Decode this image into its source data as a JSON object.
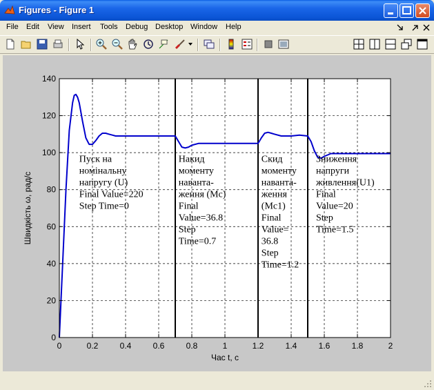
{
  "window": {
    "title": "Figures - Figure 1"
  },
  "menu": [
    {
      "label": "File"
    },
    {
      "label": "Edit"
    },
    {
      "label": "View"
    },
    {
      "label": "Insert"
    },
    {
      "label": "Tools"
    },
    {
      "label": "Debug"
    },
    {
      "label": "Desktop"
    },
    {
      "label": "Window"
    },
    {
      "label": "Help"
    }
  ],
  "colors": {
    "title_bar": "#0b55d6",
    "figure_bg": "#c8c8c8",
    "series": "#0000cc"
  },
  "icons": [
    "new-figure-icon",
    "open-file-icon",
    "save-icon",
    "print-icon",
    "pointer-icon",
    "zoom-in-icon",
    "zoom-out-icon",
    "pan-icon",
    "rotate-icon",
    "data-cursor-icon",
    "brush-icon",
    "link-icon",
    "colorbar-icon",
    "legend-icon",
    "hide-tools-icon",
    "show-tools-icon",
    "tile-icon",
    "split-vertical-icon",
    "split-horizontal-icon",
    "float-icon",
    "dock-icon"
  ],
  "chart_data": {
    "type": "line",
    "title": "",
    "xlabel": "Час t, с",
    "ylabel": "Швидкість ω, рад/с",
    "xlim": [
      0,
      2
    ],
    "ylim": [
      0,
      140
    ],
    "xticks": [
      "0",
      "0.2",
      "0.4",
      "0.6",
      "0.8",
      "1",
      "1.2",
      "1.4",
      "1.6",
      "1.8",
      "2"
    ],
    "yticks": [
      "0",
      "20",
      "40",
      "60",
      "80",
      "100",
      "120",
      "140"
    ],
    "grid": true,
    "vlines": [
      0.7,
      1.2,
      1.5
    ],
    "series": [
      {
        "x": [
          0,
          0.02,
          0.04,
          0.06,
          0.08,
          0.09,
          0.1,
          0.11,
          0.12,
          0.14,
          0.16,
          0.18,
          0.2,
          0.22,
          0.24,
          0.26,
          0.28,
          0.3,
          0.32,
          0.34,
          0.36,
          0.4,
          0.45,
          0.5,
          0.6,
          0.7,
          0.72,
          0.74,
          0.76,
          0.78,
          0.8,
          0.84,
          0.9,
          1.0,
          1.1,
          1.2,
          1.22,
          1.24,
          1.26,
          1.28,
          1.3,
          1.34,
          1.4,
          1.45,
          1.5,
          1.52,
          1.54,
          1.56,
          1.58,
          1.6,
          1.64,
          1.7,
          1.8,
          1.9,
          2.0
        ],
        "y": [
          0,
          40,
          80,
          112,
          127,
          131,
          131.5,
          130,
          127,
          117,
          108,
          104.5,
          104.5,
          106.5,
          109,
          110.5,
          110.5,
          110,
          109.5,
          109,
          109,
          109,
          109,
          109,
          109,
          109,
          106,
          103,
          102.5,
          103,
          104,
          105,
          105,
          105,
          105,
          105,
          108,
          110.5,
          111,
          110.5,
          110,
          109,
          109,
          109.5,
          109,
          106,
          101,
          97.5,
          97,
          98,
          99.5,
          99.5,
          99.5,
          99.5,
          99.5
        ]
      }
    ],
    "annotations": [
      {
        "x": 0.12,
        "lines": [
          "Пуск на",
          "номінальну",
          "напругу (U)",
          "Final Value=220",
          "Step Time=0"
        ]
      },
      {
        "x": 0.72,
        "lines": [
          "Накид",
          "моменту",
          "наванта-",
          "ження (Mc)",
          "Final",
          "Value=36.8",
          "Step",
          "Time=0.7"
        ]
      },
      {
        "x": 1.22,
        "lines": [
          "Скид",
          "моменту",
          "наванта-",
          "ження",
          "(Mc1)",
          "Final",
          "Value=",
          "36.8",
          "Step",
          "Time=1.2"
        ]
      },
      {
        "x": 1.55,
        "lines": [
          "Зниження",
          "напруги",
          "живлення(U1)",
          "Final",
          "Value=20",
          "Step",
          "Time=1.5"
        ]
      }
    ]
  }
}
